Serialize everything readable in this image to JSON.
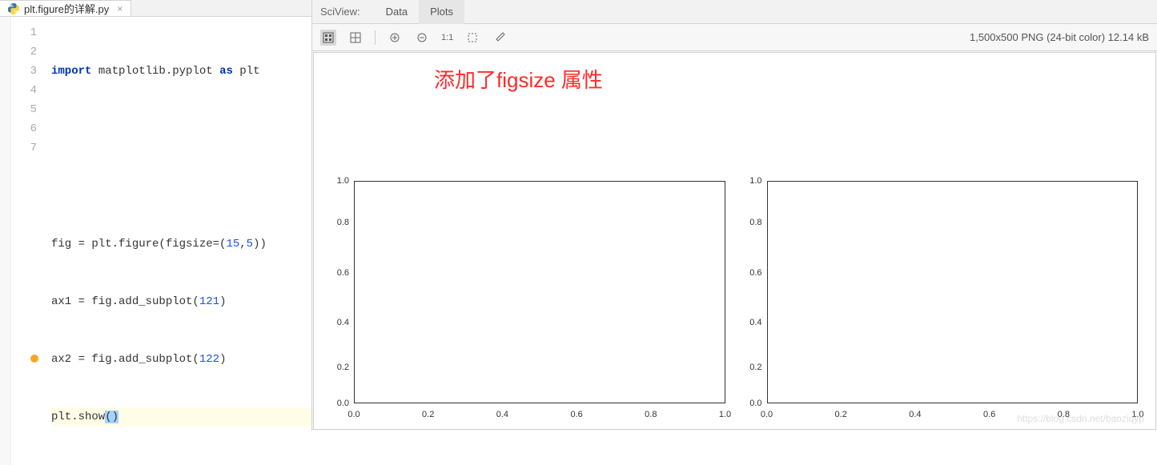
{
  "editor": {
    "tab_filename": "plt.figure的详解.py",
    "lines": {
      "l1_kw1": "import",
      "l1_mid": " matplotlib.pyplot ",
      "l1_kw2": "as",
      "l1_end": " plt",
      "l4_pre": "fig = plt.figure(figsize=(",
      "l4_n1": "15",
      "l4_c": ",",
      "l4_n2": "5",
      "l4_post": "))",
      "l5_pre": "ax1 = fig.add_subplot(",
      "l5_n": "121",
      "l5_post": ")",
      "l6_pre": "ax2 = fig.add_subplot(",
      "l6_n": "122",
      "l6_post": ")",
      "l7_pre": "plt.show",
      "l7_paren": "()"
    },
    "line_numbers": [
      "1",
      "2",
      "3",
      "4",
      "5",
      "6",
      "7"
    ]
  },
  "sciview": {
    "title": "SciView:",
    "tabs": {
      "data": "Data",
      "plots": "Plots"
    },
    "status": "1,500x500 PNG (24-bit color) 12.14 kB",
    "toolbar_1to1": "1:1"
  },
  "annotation": "添加了figsize 属性",
  "watermark": "https://blog.csdn.net/baoziqyp",
  "chart_data": [
    {
      "type": "line",
      "title": "",
      "xlabel": "",
      "ylabel": "",
      "xlim": [
        0.0,
        1.0
      ],
      "ylim": [
        0.0,
        1.0
      ],
      "xticks": [
        0.0,
        0.2,
        0.4,
        0.6,
        0.8,
        1.0
      ],
      "yticks": [
        0.0,
        0.2,
        0.4,
        0.6,
        0.8,
        1.0
      ],
      "series": []
    },
    {
      "type": "line",
      "title": "",
      "xlabel": "",
      "ylabel": "",
      "xlim": [
        0.0,
        1.0
      ],
      "ylim": [
        0.0,
        1.0
      ],
      "xticks": [
        0.0,
        0.2,
        0.4,
        0.6,
        0.8,
        1.0
      ],
      "yticks": [
        0.0,
        0.2,
        0.4,
        0.6,
        0.8,
        1.0
      ],
      "series": []
    }
  ],
  "tick_labels": {
    "y": [
      "1.0",
      "0.8",
      "0.6",
      "0.4",
      "0.2",
      "0.0"
    ],
    "x": [
      "0.0",
      "0.2",
      "0.4",
      "0.6",
      "0.8",
      "1.0"
    ]
  }
}
